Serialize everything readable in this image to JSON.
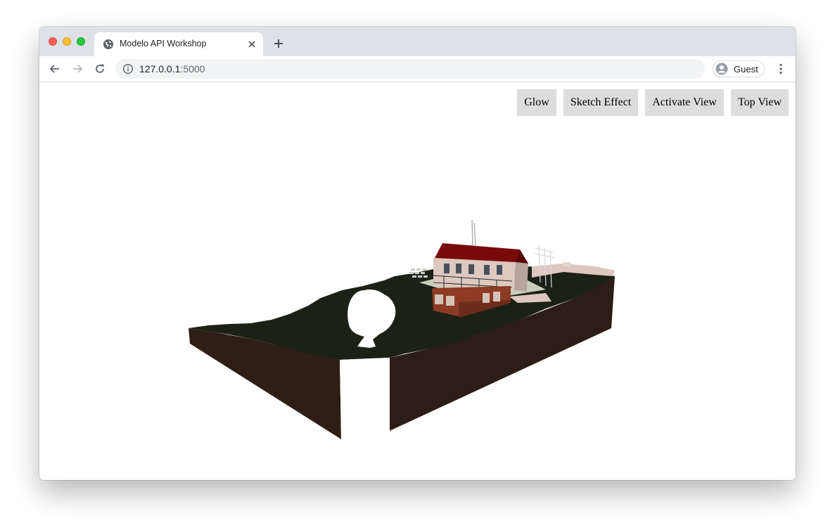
{
  "browser": {
    "tab_title": "Modelo API Workshop",
    "url_host": "127.0.0.1",
    "url_port": ":5000",
    "profile_label": "Guest"
  },
  "icons": {
    "favicon": "globe-icon",
    "tab_close": "close-icon",
    "new_tab": "plus-icon",
    "back": "arrow-left-icon",
    "forward": "arrow-right-icon",
    "reload": "reload-icon",
    "site_info": "info-icon",
    "profile": "avatar-icon",
    "menu": "kebab-menu-icon"
  },
  "toolbar_buttons": {
    "glow": "Glow",
    "sketch": "Sketch Effect",
    "activate": "Activate View",
    "top": "Top View"
  },
  "scene": {
    "model": "site-3d-model"
  },
  "colors": {
    "tabstrip": "#dee1e6",
    "button_bg": "#dddddd",
    "terrain_top": "#1d2116",
    "terrain_side": "#2e1f17",
    "roof": "#7a0a0a",
    "facade_brick": "#8d3b24",
    "facade_plaster": "#d8c4bc"
  }
}
